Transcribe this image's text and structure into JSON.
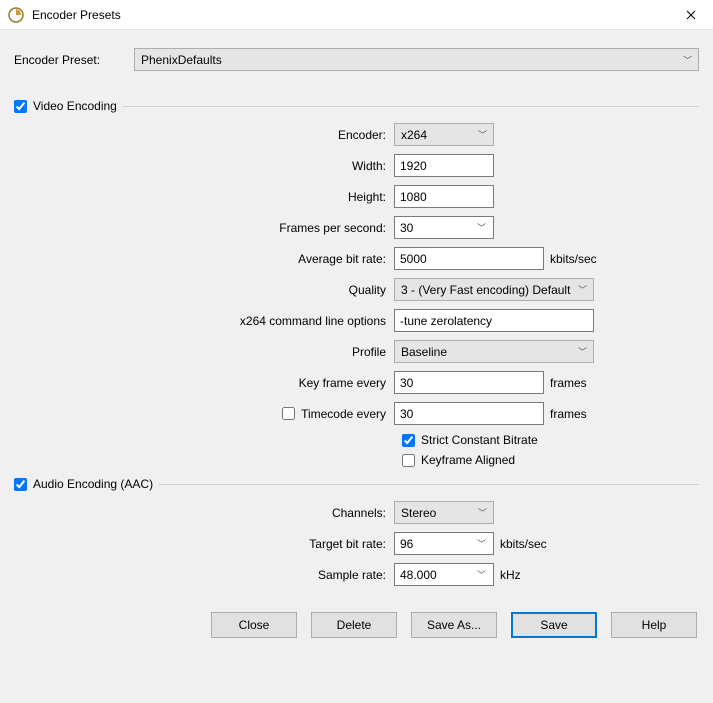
{
  "window": {
    "title": "Encoder Presets"
  },
  "preset": {
    "label": "Encoder Preset:",
    "value": "PhenixDefaults"
  },
  "video": {
    "section_label": "Video Encoding",
    "checked": true,
    "encoder_label": "Encoder:",
    "encoder_value": "x264",
    "width_label": "Width:",
    "width_value": "1920",
    "height_label": "Height:",
    "height_value": "1080",
    "fps_label": "Frames per second:",
    "fps_value": "30",
    "avg_bitrate_label": "Average bit rate:",
    "avg_bitrate_value": "5000",
    "avg_bitrate_unit": "kbits/sec",
    "quality_label": "Quality",
    "quality_value": "3 - (Very Fast encoding) Default",
    "cmdline_label": "x264 command line options",
    "cmdline_value": "-tune zerolatency",
    "profile_label": "Profile",
    "profile_value": "Baseline",
    "keyframe_label": "Key frame every",
    "keyframe_value": "30",
    "keyframe_unit": "frames",
    "timecode_label": "Timecode every",
    "timecode_checked": false,
    "timecode_value": "30",
    "timecode_unit": "frames",
    "strict_cbr_label": "Strict Constant Bitrate",
    "strict_cbr_checked": true,
    "keyframe_aligned_label": "Keyframe Aligned",
    "keyframe_aligned_checked": false
  },
  "audio": {
    "section_label": "Audio Encoding (AAC)",
    "checked": true,
    "channels_label": "Channels:",
    "channels_value": "Stereo",
    "target_bitrate_label": "Target bit rate:",
    "target_bitrate_value": "96",
    "target_bitrate_unit": "kbits/sec",
    "sample_rate_label": "Sample rate:",
    "sample_rate_value": "48.000",
    "sample_rate_unit": "kHz"
  },
  "buttons": {
    "close": "Close",
    "delete": "Delete",
    "save_as": "Save As...",
    "save": "Save",
    "help": "Help"
  }
}
